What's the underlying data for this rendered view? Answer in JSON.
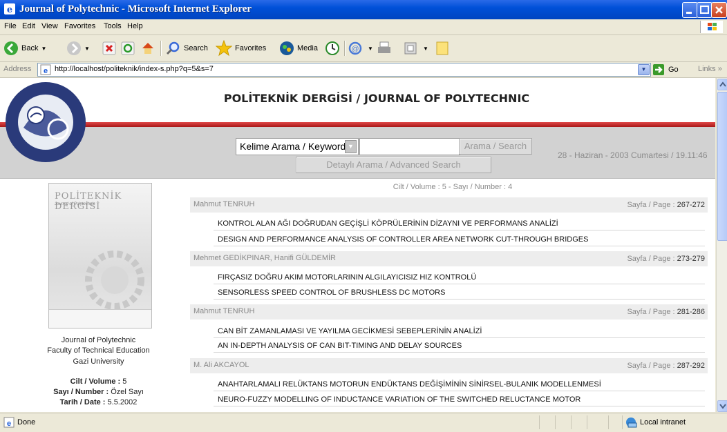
{
  "window": {
    "title": "Journal of Polytechnic - Microsoft Internet Explorer"
  },
  "menu": [
    "File",
    "Edit",
    "View",
    "Favorites",
    "Tools",
    "Help"
  ],
  "toolbar": {
    "back": "Back",
    "search": "Search",
    "favorites": "Favorites",
    "media": "Media"
  },
  "address": {
    "label": "Address",
    "url": "http://localhost/politeknik/index-s.php?q=5&s=7",
    "go": "Go",
    "links": "Links"
  },
  "page": {
    "title": "POLİTEKNİK DERGİSİ / JOURNAL OF POLYTECHNIC",
    "search": {
      "select_value": "Kelime Arama / Keyword",
      "input_value": "",
      "search_button": "Arama / Search",
      "advanced_button": "Detaylı Arama / Advanced Search"
    },
    "datetime": "28 - Haziran - 2003 Cumartesi / 19.11:46",
    "cover": {
      "title": "POLİTEKNİK DERGİSİ",
      "subtitle": "Journal of Polytechnic"
    },
    "info": {
      "line1": "Journal of Polytechnic",
      "line2": "Faculty of Technical Education",
      "line3": "Gazi University",
      "volume_label": "Cilt / Volume :",
      "volume_value": "5",
      "number_label": "Sayı / Number :",
      "number_value": "Özel Sayı",
      "date_label": "Tarih / Date :",
      "date_value": "5.5.2002"
    },
    "volume_header": "Cilt / Volume : 5 - Sayı / Number : 4",
    "page_label": "Sayfa / Page :",
    "articles": [
      {
        "authors": "Mahmut TENRUH",
        "pages": "267-272",
        "title_tr": "KONTROL ALAN AĞI DOĞRUDAN GEÇİŞLİ KÖPRÜLERİNİN DİZAYNI VE PERFORMANS ANALİZİ",
        "title_en": "DESIGN AND PERFORMANCE ANALYSIS OF CONTROLLER AREA NETWORK CUT-THROUGH BRIDGES"
      },
      {
        "authors": "Mehmet GEDİKPINAR, Hanifi GÜLDEMİR",
        "pages": "273-279",
        "title_tr": "FIRÇASIZ DOĞRU AKIM MOTORLARININ ALGILAYICISIZ HIZ KONTROLÜ",
        "title_en": "SENSORLESS SPEED CONTROL OF BRUSHLESS DC MOTORS"
      },
      {
        "authors": "Mahmut TENRUH",
        "pages": "281-286",
        "title_tr": "CAN BİT ZAMANLAMASI VE YAYILMA GECİKMESİ SEBEPLERİNİN ANALİZİ",
        "title_en": "AN IN-DEPTH ANALYSIS OF CAN BIT-TIMING AND DELAY SOURCES"
      },
      {
        "authors": "M. Ali AKCAYOL",
        "pages": "287-292",
        "title_tr": "ANAHTARLAMALI RELÜKTANS MOTORUN ENDÜKTANS DEĞİŞİMİNİN SİNİRSEL-BULANIK MODELLENMESİ",
        "title_en": "NEURO-FUZZY MODELLING OF INDUCTANCE VARIATION OF THE SWITCHED RELUCTANCE MOTOR"
      }
    ]
  },
  "status": {
    "text": "Done",
    "zone": "Local intranet"
  }
}
